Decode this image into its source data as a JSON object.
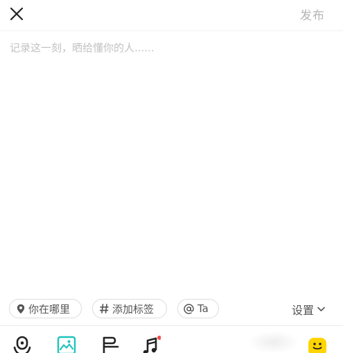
{
  "header": {
    "close_icon": "close-icon",
    "publish_label": "发布"
  },
  "composer": {
    "placeholder": "记录这一刻，晒给懂你的人......",
    "value": ""
  },
  "chips": {
    "location": {
      "icon": "location-pin-icon",
      "label": "你在哪里"
    },
    "tag": {
      "icon": "hashtag-icon",
      "label": "添加标签"
    },
    "mention": {
      "icon": "at-icon",
      "label": "Ta"
    }
  },
  "settings": {
    "label": "设置",
    "icon": "chevron-down-icon"
  },
  "toolbar": {
    "items": [
      {
        "icon": "voice-icon"
      },
      {
        "icon": "image-icon",
        "active": true
      },
      {
        "icon": "text-format-icon"
      },
      {
        "icon": "music-icon",
        "has_dot": true
      },
      {
        "icon": "emoji-icon"
      }
    ]
  },
  "colors": {
    "accent": "#1fc3bd",
    "emoji": "#ffd400",
    "notification_dot": "#f24b4b",
    "placeholder": "#c2c2c2",
    "publish_disabled": "#b5b5b5"
  }
}
